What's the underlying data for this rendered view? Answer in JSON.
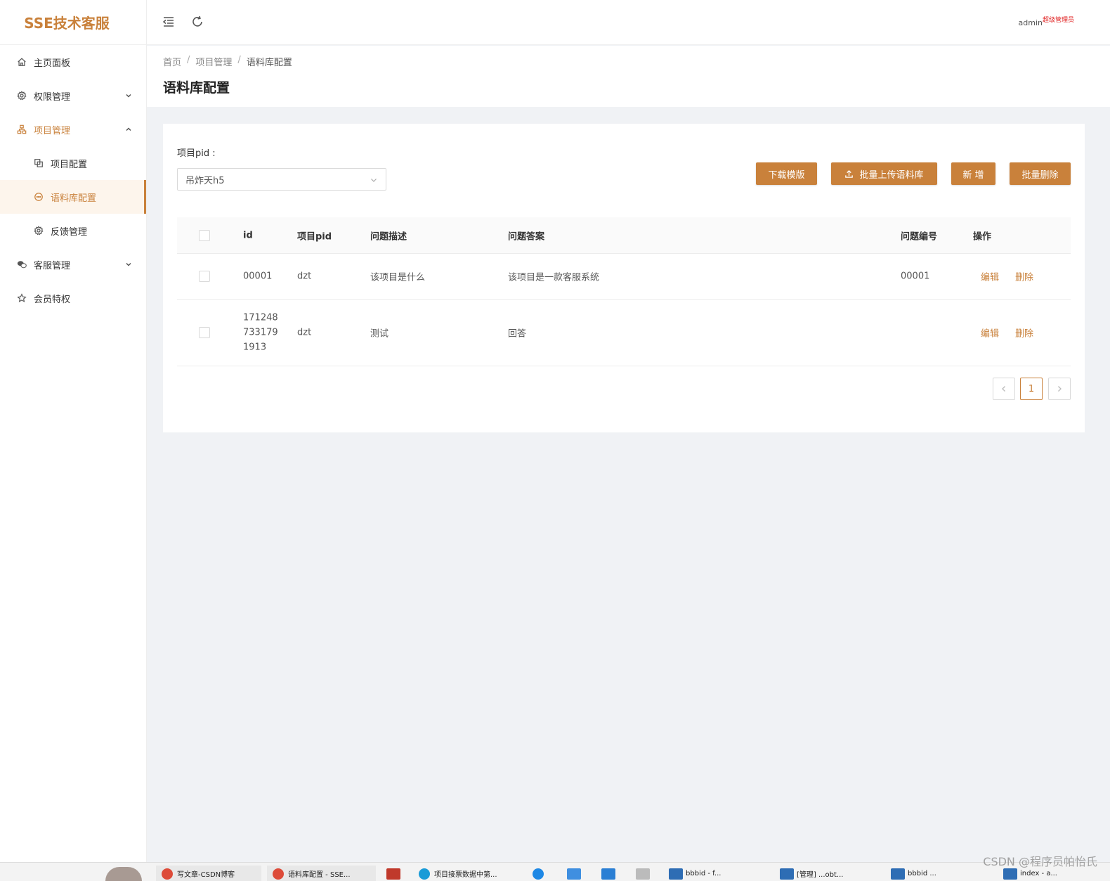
{
  "app": {
    "title": "SSE技术客服"
  },
  "sidebar": {
    "items": [
      {
        "label": "主页面板",
        "icon": "home-icon"
      },
      {
        "label": "权限管理",
        "icon": "gear-icon"
      },
      {
        "label": "项目管理",
        "icon": "sitemap-icon"
      },
      {
        "label": "项目配置",
        "icon": "copy-icon"
      },
      {
        "label": "语料库配置",
        "icon": "message-icon"
      },
      {
        "label": "反馈管理",
        "icon": "gear-icon"
      },
      {
        "label": "客服管理",
        "icon": "wechat-icon"
      },
      {
        "label": "会员特权",
        "icon": "star-icon"
      }
    ]
  },
  "header": {
    "user": "admin",
    "role": "超级管理员"
  },
  "breadcrumb": [
    "首页",
    "项目管理",
    "语料库配置"
  ],
  "page": {
    "title": "语料库配置"
  },
  "filter": {
    "label": "项目pid :",
    "selected": "吊炸天h5"
  },
  "buttons": {
    "download": "下载模版",
    "upload": "批量上传语料库",
    "add": "新 增",
    "batch_delete": "批量删除"
  },
  "table": {
    "columns": [
      "id",
      "项目pid",
      "问题描述",
      "问题答案",
      "问题编号",
      "操作"
    ],
    "rows": [
      {
        "id": "00001",
        "pid": "dzt",
        "question": "该项目是什么",
        "answer": "该项目是一款客服系统",
        "number": "00001"
      },
      {
        "id_lines": [
          "171248",
          "733179",
          "1913"
        ],
        "pid": "dzt",
        "question": "测试",
        "answer": "回答",
        "number": ""
      }
    ],
    "actions": {
      "edit": "编辑",
      "delete": "删除"
    }
  },
  "pagination": {
    "current": "1"
  },
  "taskbar": {
    "items": [
      "写文章-CSDN博客",
      "语料库配置 - SSE...",
      "项目接票数据中第...",
      "bbbid - f...",
      "[管理] ...obt...",
      "bbbid ...",
      "index - a..."
    ]
  },
  "watermark": "CSDN @程序员帕怡氏"
}
